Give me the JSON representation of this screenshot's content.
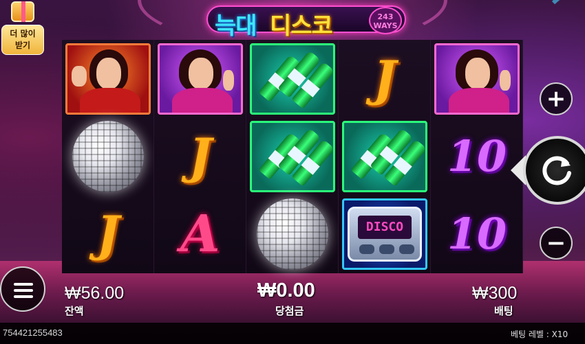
{
  "game": {
    "logo_text_left": "늑대",
    "logo_text_right": "디스코",
    "ways_number": "243",
    "ways_label": "WAYS"
  },
  "promo": {
    "label_line1": "더 많이",
    "label_line2": "받기"
  },
  "reels": [
    [
      "man-in-red-jacket",
      "disco-ball",
      "letter-j"
    ],
    [
      "woman-in-pink",
      "letter-j",
      "letter-a"
    ],
    [
      "green-bottles",
      "green-bottles",
      "disco-ball"
    ],
    [
      "letter-j",
      "green-bottles",
      "disco-pager"
    ],
    [
      "woman-in-pink",
      "number-10",
      "number-10"
    ]
  ],
  "symbols": {
    "letter_j": "J",
    "letter_a": "A",
    "number_10": "10",
    "pager_text": "DISCO"
  },
  "balance": {
    "amount": "₩56.00",
    "label": "잔액"
  },
  "win": {
    "amount": "₩0.00",
    "label": "당첨금"
  },
  "bet": {
    "amount": "₩300",
    "label": "배팅"
  },
  "round_id": "754421255483",
  "bet_level": {
    "label": "베팅 레벨 :",
    "value": "X10"
  },
  "controls": {
    "plus_icon": "+",
    "minus_icon": "−",
    "spin_icon": "refresh-icon",
    "menu_icon": "hamburger-icon"
  },
  "colors": {
    "accent_pink": "#ff4fd0",
    "logo_cyan": "#3ee6ff",
    "logo_yellow": "#ffe23a"
  }
}
